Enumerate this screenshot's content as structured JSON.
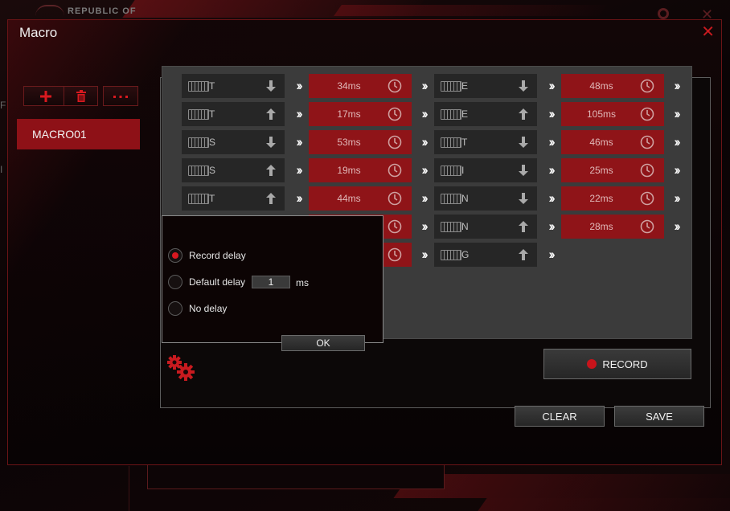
{
  "background_app": {
    "logo_text": "REPUBLIC OF",
    "edge_letters": [
      "F",
      "I"
    ]
  },
  "dialog": {
    "title": "Macro",
    "close_glyph": "✕"
  },
  "toolbar": {
    "add_icon": "plus-icon",
    "delete_icon": "trash-icon",
    "more_icon": "more-icon"
  },
  "macros": [
    {
      "name": "MACRO01",
      "selected": true
    }
  ],
  "editor": {
    "columns": [
      {
        "events": [
          {
            "key": "T",
            "direction": "down",
            "delay": "34ms"
          },
          {
            "key": "T",
            "direction": "up",
            "delay": "17ms"
          },
          {
            "key": "S",
            "direction": "down",
            "delay": "53ms"
          },
          {
            "key": "S",
            "direction": "up",
            "delay": "19ms"
          },
          {
            "key": "T",
            "direction": "up",
            "delay": "44ms"
          },
          {
            "key": "",
            "direction": "",
            "delay": ""
          },
          {
            "key": "",
            "direction": "",
            "delay": ""
          }
        ]
      },
      {
        "events": [
          {
            "key": "E",
            "direction": "down",
            "delay": "48ms"
          },
          {
            "key": "E",
            "direction": "up",
            "delay": "105ms"
          },
          {
            "key": "T",
            "direction": "down",
            "delay": "46ms"
          },
          {
            "key": "I",
            "direction": "down",
            "delay": "25ms"
          },
          {
            "key": "N",
            "direction": "down",
            "delay": "22ms"
          },
          {
            "key": "N",
            "direction": "up",
            "delay": "28ms"
          },
          {
            "key": "G",
            "direction": "up",
            "delay": ""
          }
        ]
      }
    ]
  },
  "delay_popup": {
    "options": [
      {
        "label": "Record delay",
        "selected": true
      },
      {
        "label": "Default delay",
        "selected": false
      },
      {
        "label": "No delay",
        "selected": false
      }
    ],
    "default_delay_value": "1",
    "unit": "ms",
    "ok_label": "OK"
  },
  "buttons": {
    "record": "RECORD",
    "clear": "CLEAR",
    "save": "SAVE"
  },
  "colors": {
    "accent_red": "#8f1418",
    "close_red": "#c81a1f",
    "record_dot": "#c8141b",
    "editor_bg": "#3b3b3b",
    "key_cell_bg": "#262626"
  }
}
